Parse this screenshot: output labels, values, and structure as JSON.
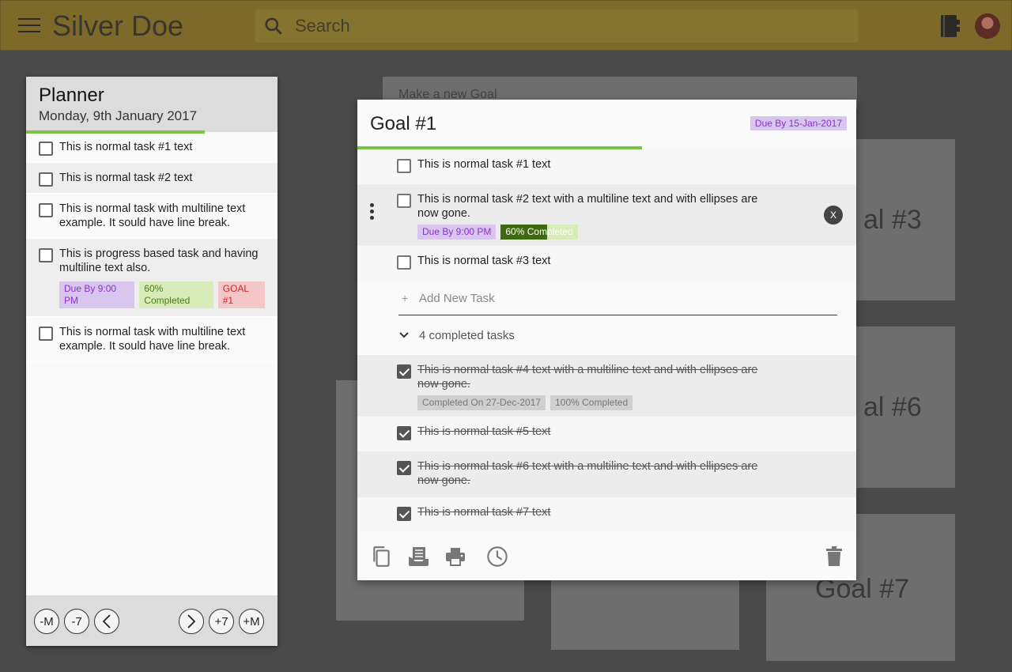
{
  "header": {
    "app_title": "Silver Doe",
    "search_placeholder": "Search",
    "accent": "#7d6a2a"
  },
  "planner": {
    "title": "Planner",
    "date": "Monday, 9th January 2017",
    "progress": 0.71,
    "tasks": [
      {
        "text": "This is normal task #1 text"
      },
      {
        "text": "This is normal task #2 text"
      },
      {
        "text": "This is normal task with multiline text example. It sould have line break."
      },
      {
        "text": "This is progress based task and having multiline text also.",
        "due": "Due By 9:00 PM",
        "progress": "60% Completed",
        "goal": "GOAL #1"
      },
      {
        "text": "This is normal task with multiline text example. It sould have line break."
      }
    ],
    "nav": {
      "minus_month": "-M",
      "minus_week": "-7",
      "plus_week": "+7",
      "plus_month": "+M"
    }
  },
  "background": {
    "new_goal_placeholder": "Make a new Goal",
    "goals": [
      "al #3",
      "al #6",
      "Goal #7"
    ]
  },
  "goal_dialog": {
    "title": "Goal #1",
    "due": "Due By 15-Jan-2017",
    "progress": 0.57,
    "tasks": [
      {
        "text": "This is normal task #1 text"
      },
      {
        "text": "This is normal task #2 text with a multiline text and with ellipses are now gone.",
        "due": "Due By 9:00 PM",
        "progress_label": "60% Completed",
        "progress": 0.6,
        "remove_label": "X"
      },
      {
        "text": "This is normal task #3 text"
      }
    ],
    "add_task_placeholder": "Add New Task",
    "add_task_plus": "+",
    "completed_label": "4 completed tasks",
    "completed_tasks": [
      {
        "text": "This is normal task #4 text with a multiline text and with ellipses are now gone.",
        "completed_on": "Completed On 27-Dec-2017",
        "progress_label": "100% Completed"
      },
      {
        "text": "This is normal task #5 text"
      },
      {
        "text": "This is normal task #6 text with a multiline text and with ellipses are now gone."
      },
      {
        "text": "This is normal task #7 text"
      }
    ],
    "footer_icons": [
      "copy-icon",
      "move-to-icon",
      "print-icon",
      "history-icon",
      "delete-icon"
    ]
  }
}
